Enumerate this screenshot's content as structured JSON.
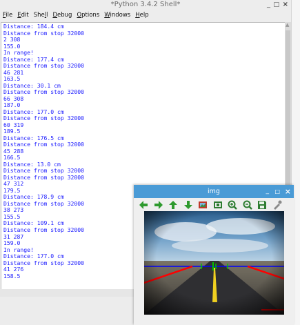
{
  "shell": {
    "title": "*Python 3.4.2 Shell*",
    "controls": {
      "minimize": "_",
      "maximize": "□",
      "close": "×"
    },
    "menu": [
      {
        "underline": "F",
        "rest": "ile"
      },
      {
        "underline": "E",
        "rest": "dit"
      },
      {
        "pre": "She",
        "underline": "l",
        "rest": "l"
      },
      {
        "underline": "D",
        "rest": "ebug"
      },
      {
        "underline": "O",
        "rest": "ptions"
      },
      {
        "underline": "W",
        "rest": "indows"
      },
      {
        "underline": "H",
        "rest": "elp"
      }
    ],
    "lines": [
      "Distance: 184.4 cm",
      "Distance from stop 32000",
      "2 308",
      "155.0",
      "In range!",
      "Distance: 177.4 cm",
      "Distance from stop 32000",
      "46 281",
      "163.5",
      "Distance: 30.1 cm",
      "Distance from stop 32000",
      "66 308",
      "187.0",
      "Distance: 177.0 cm",
      "Distance from stop 32000",
      "60 319",
      "189.5",
      "Distance: 176.5 cm",
      "Distance from stop 32000",
      "45 288",
      "166.5",
      "Distance: 13.0 cm",
      "Distance from stop 32000",
      "Distance from stop 32000",
      "47 312",
      "179.5",
      "Distance: 178.9 cm",
      "Distance from stop 32000",
      "38 273",
      "155.5",
      "Distance: 109.1 cm",
      "Distance from stop 32000",
      "31 287",
      "159.0",
      "In range!",
      "Distance: 177.0 cm",
      "Distance from stop 32000",
      "41 276",
      "158.5"
    ]
  },
  "img_window": {
    "title": "img",
    "controls": {
      "minimize": "_",
      "maximize": "□",
      "close": "×"
    },
    "toolbar_icons": [
      {
        "name": "arrow-left-icon",
        "color": "#2e9a2e"
      },
      {
        "name": "arrow-right-icon",
        "color": "#2e9a2e"
      },
      {
        "name": "arrow-up-icon",
        "color": "#2e9a2e"
      },
      {
        "name": "arrow-down-icon",
        "color": "#2e9a2e"
      },
      {
        "name": "image-icon",
        "color": "#c0392b"
      },
      {
        "name": "fit-window-icon",
        "color": "#2e7d32"
      },
      {
        "name": "zoom-in-icon",
        "color": "#2e7d32"
      },
      {
        "name": "zoom-out-icon",
        "color": "#2e7d32"
      },
      {
        "name": "save-icon",
        "color": "#2e7d32"
      },
      {
        "name": "properties-icon",
        "color": "#8a8a8a"
      }
    ]
  },
  "colors": {
    "shell_text": "#1a1aff",
    "img_titlebar": "#4a9bd6",
    "lane_line": "#ff0000",
    "horizon_line": "#0000ff",
    "marker": "#00c000",
    "center_line": "#f0d020"
  }
}
